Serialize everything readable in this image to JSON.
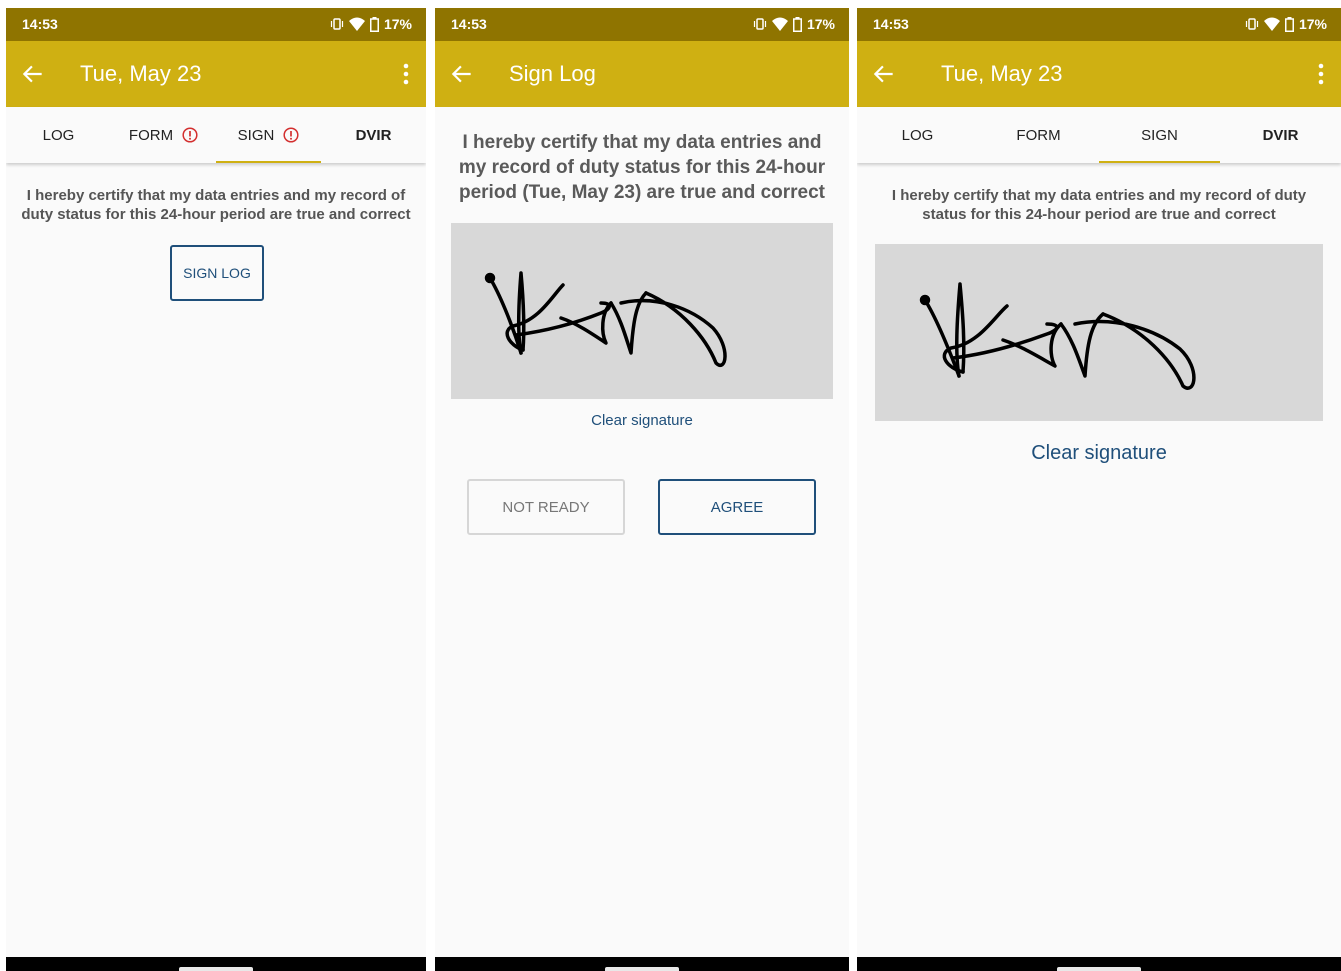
{
  "status": {
    "time": "14:53",
    "battery": "17%"
  },
  "screens": [
    {
      "title": "Tue, May 23",
      "tabs": [
        {
          "label": "LOG",
          "alert": false
        },
        {
          "label": "FORM",
          "alert": true
        },
        {
          "label": "SIGN",
          "alert": true,
          "active": true
        },
        {
          "label": "DVIR",
          "alert": false
        }
      ],
      "certify_text": "I hereby certify that my data entries and my record of duty status for this 24-hour period are true and correct",
      "sign_button": "SIGN LOG"
    },
    {
      "title": "Sign Log",
      "certify_text": "I hereby certify that my data entries and my record of duty status for this 24-hour period (Tue, May 23) are true and correct",
      "clear_signature": "Clear signature",
      "not_ready_button": "NOT READY",
      "agree_button": "AGREE"
    },
    {
      "title": "Tue, May 23",
      "tabs": [
        {
          "label": "LOG",
          "alert": false
        },
        {
          "label": "FORM",
          "alert": false
        },
        {
          "label": "SIGN",
          "alert": false,
          "active": true
        },
        {
          "label": "DVIR",
          "alert": false
        }
      ],
      "certify_text": "I hereby certify that my data entries and my record of duty status for this 24-hour period are true and correct",
      "clear_signature": "Clear signature"
    }
  ],
  "colors": {
    "status_bar": "#8f7400",
    "app_bar": "#cfb012",
    "link": "#1f4f7a",
    "alert": "#d32f2f",
    "signature_bg": "#d8d8d8"
  },
  "icons": [
    "back-arrow-icon",
    "more-vert-icon",
    "vibrate-icon",
    "wifi-icon",
    "battery-icon",
    "alert-icon"
  ]
}
